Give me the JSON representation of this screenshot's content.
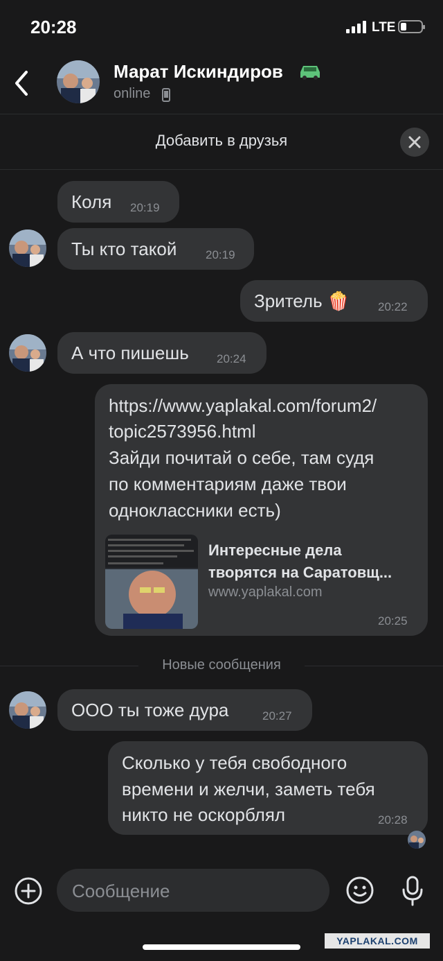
{
  "status_bar": {
    "time": "20:28",
    "network": "LTE"
  },
  "header": {
    "name": "Марат Искиндиров",
    "status": "online",
    "back_icon": "chevron-left-icon",
    "car_icon": "car-icon"
  },
  "banner": {
    "text": "Добавить в друзья",
    "close_icon": "close-icon"
  },
  "messages": [
    {
      "text": "Коля",
      "time": "20:19"
    },
    {
      "text": "Ты кто такой",
      "time": "20:19"
    },
    {
      "text": "Зритель 🍿",
      "time": "20:22"
    },
    {
      "text": "А что пишешь",
      "time": "20:24"
    },
    {
      "link_line1": "https://www.yaplakal.com/forum2/",
      "link_line2": "topic2573956.html",
      "body_line1": "Зайди почитай о себе, там судя",
      "body_line2": "по комментариям даже твои",
      "body_line3": "одноклассники есть)",
      "preview_title_line1": "Интересные дела",
      "preview_title_line2": "творятся на Саратовщ...",
      "preview_domain": "www.yaplakal.com",
      "time": "20:25"
    },
    {
      "text": "ООО ты тоже дура",
      "time": "20:27"
    },
    {
      "line1": "Сколько у тебя свободного",
      "line2": "времени и желчи, заметь тебя",
      "line3": "никто не оскорблял",
      "time": "20:28"
    }
  ],
  "new_messages_divider": "Новые сообщения",
  "composer": {
    "placeholder": "Сообщение"
  },
  "watermark": "YAPLAKAL.COM",
  "colors": {
    "background": "#19191a",
    "bubble": "#333436",
    "link": "#71aaeb",
    "muted": "#8b8e93"
  }
}
